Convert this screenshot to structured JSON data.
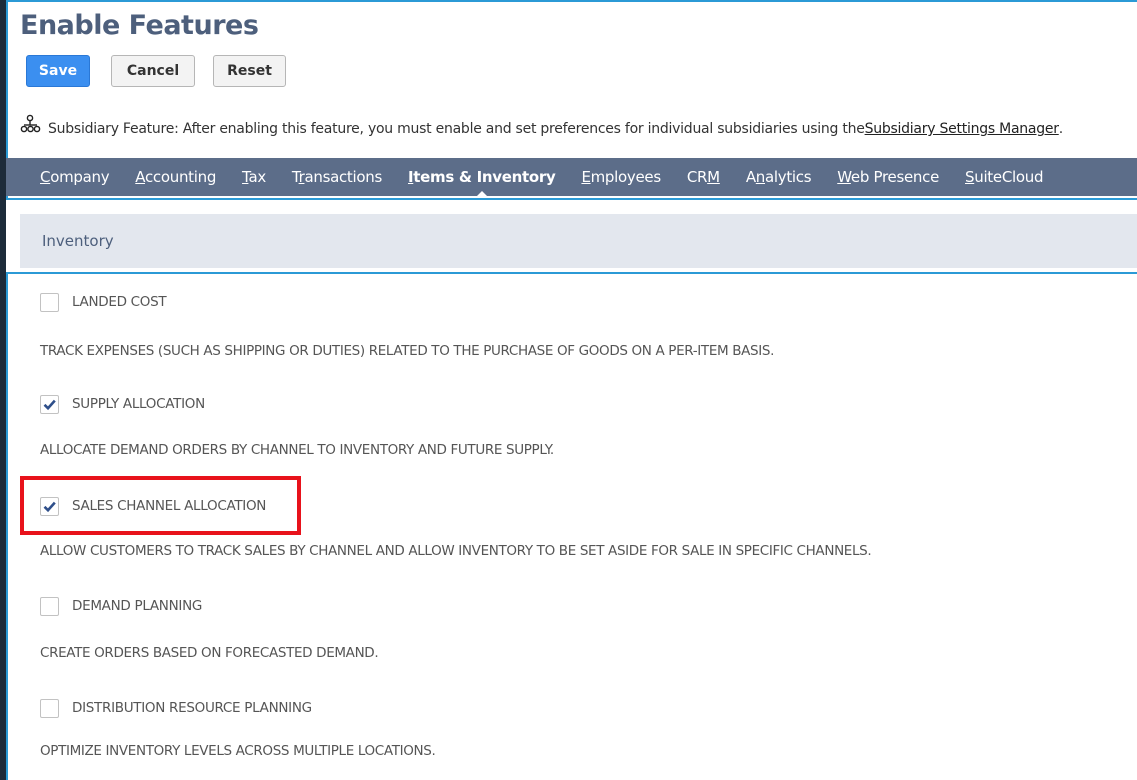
{
  "page": {
    "title": "Enable Features"
  },
  "toolbar": {
    "save_label": "Save",
    "cancel_label": "Cancel",
    "reset_label": "Reset"
  },
  "notice": {
    "text": "Subsidiary Feature: After enabling this feature, you must enable and set preferences for individual subsidiaries using the ",
    "link": "Subsidiary Settings Manager",
    "end": "."
  },
  "tabs": [
    {
      "pre": "",
      "key": "C",
      "post": "ompany"
    },
    {
      "pre": "",
      "key": "A",
      "post": "ccounting"
    },
    {
      "pre": "",
      "key": "T",
      "post": "ax"
    },
    {
      "pre": "T",
      "key": "r",
      "post": "ansactions"
    },
    {
      "pre": "",
      "key": "I",
      "post": "tems & Inventory"
    },
    {
      "pre": "",
      "key": "E",
      "post": "mployees"
    },
    {
      "pre": "CR",
      "key": "M",
      "post": ""
    },
    {
      "pre": "A",
      "key": "n",
      "post": "alytics"
    },
    {
      "pre": "",
      "key": "W",
      "post": "eb Presence"
    },
    {
      "pre": "",
      "key": "S",
      "post": "uiteCloud"
    }
  ],
  "active_tab": "Items & Inventory",
  "section": {
    "title": "Inventory"
  },
  "features": [
    {
      "label": "LANDED COST",
      "description": "TRACK EXPENSES (SUCH AS SHIPPING OR DUTIES) RELATED TO THE PURCHASE OF GOODS ON A PER-ITEM BASIS.",
      "checked": false
    },
    {
      "label": "SUPPLY ALLOCATION",
      "description": "ALLOCATE DEMAND ORDERS BY CHANNEL TO INVENTORY AND FUTURE SUPPLY.",
      "checked": true
    },
    {
      "label": "SALES CHANNEL ALLOCATION",
      "description": "ALLOW CUSTOMERS TO TRACK SALES BY CHANNEL AND ALLOW INVENTORY TO BE SET ASIDE FOR SALE IN SPECIFIC CHANNELS.",
      "checked": true,
      "highlighted": true
    },
    {
      "label": "DEMAND PLANNING",
      "description": "CREATE ORDERS BASED ON FORECASTED DEMAND.",
      "checked": false
    },
    {
      "label": "DISTRIBUTION RESOURCE PLANNING",
      "description": "OPTIMIZE INVENTORY LEVELS ACROSS MULTIPLE LOCATIONS.",
      "checked": false
    }
  ],
  "colors": {
    "accent": "#2b9ad6",
    "tab_bar": "#5c6d89",
    "save_button": "#3b8ff0",
    "highlight": "#e8121b",
    "title": "#4d5f7c"
  }
}
